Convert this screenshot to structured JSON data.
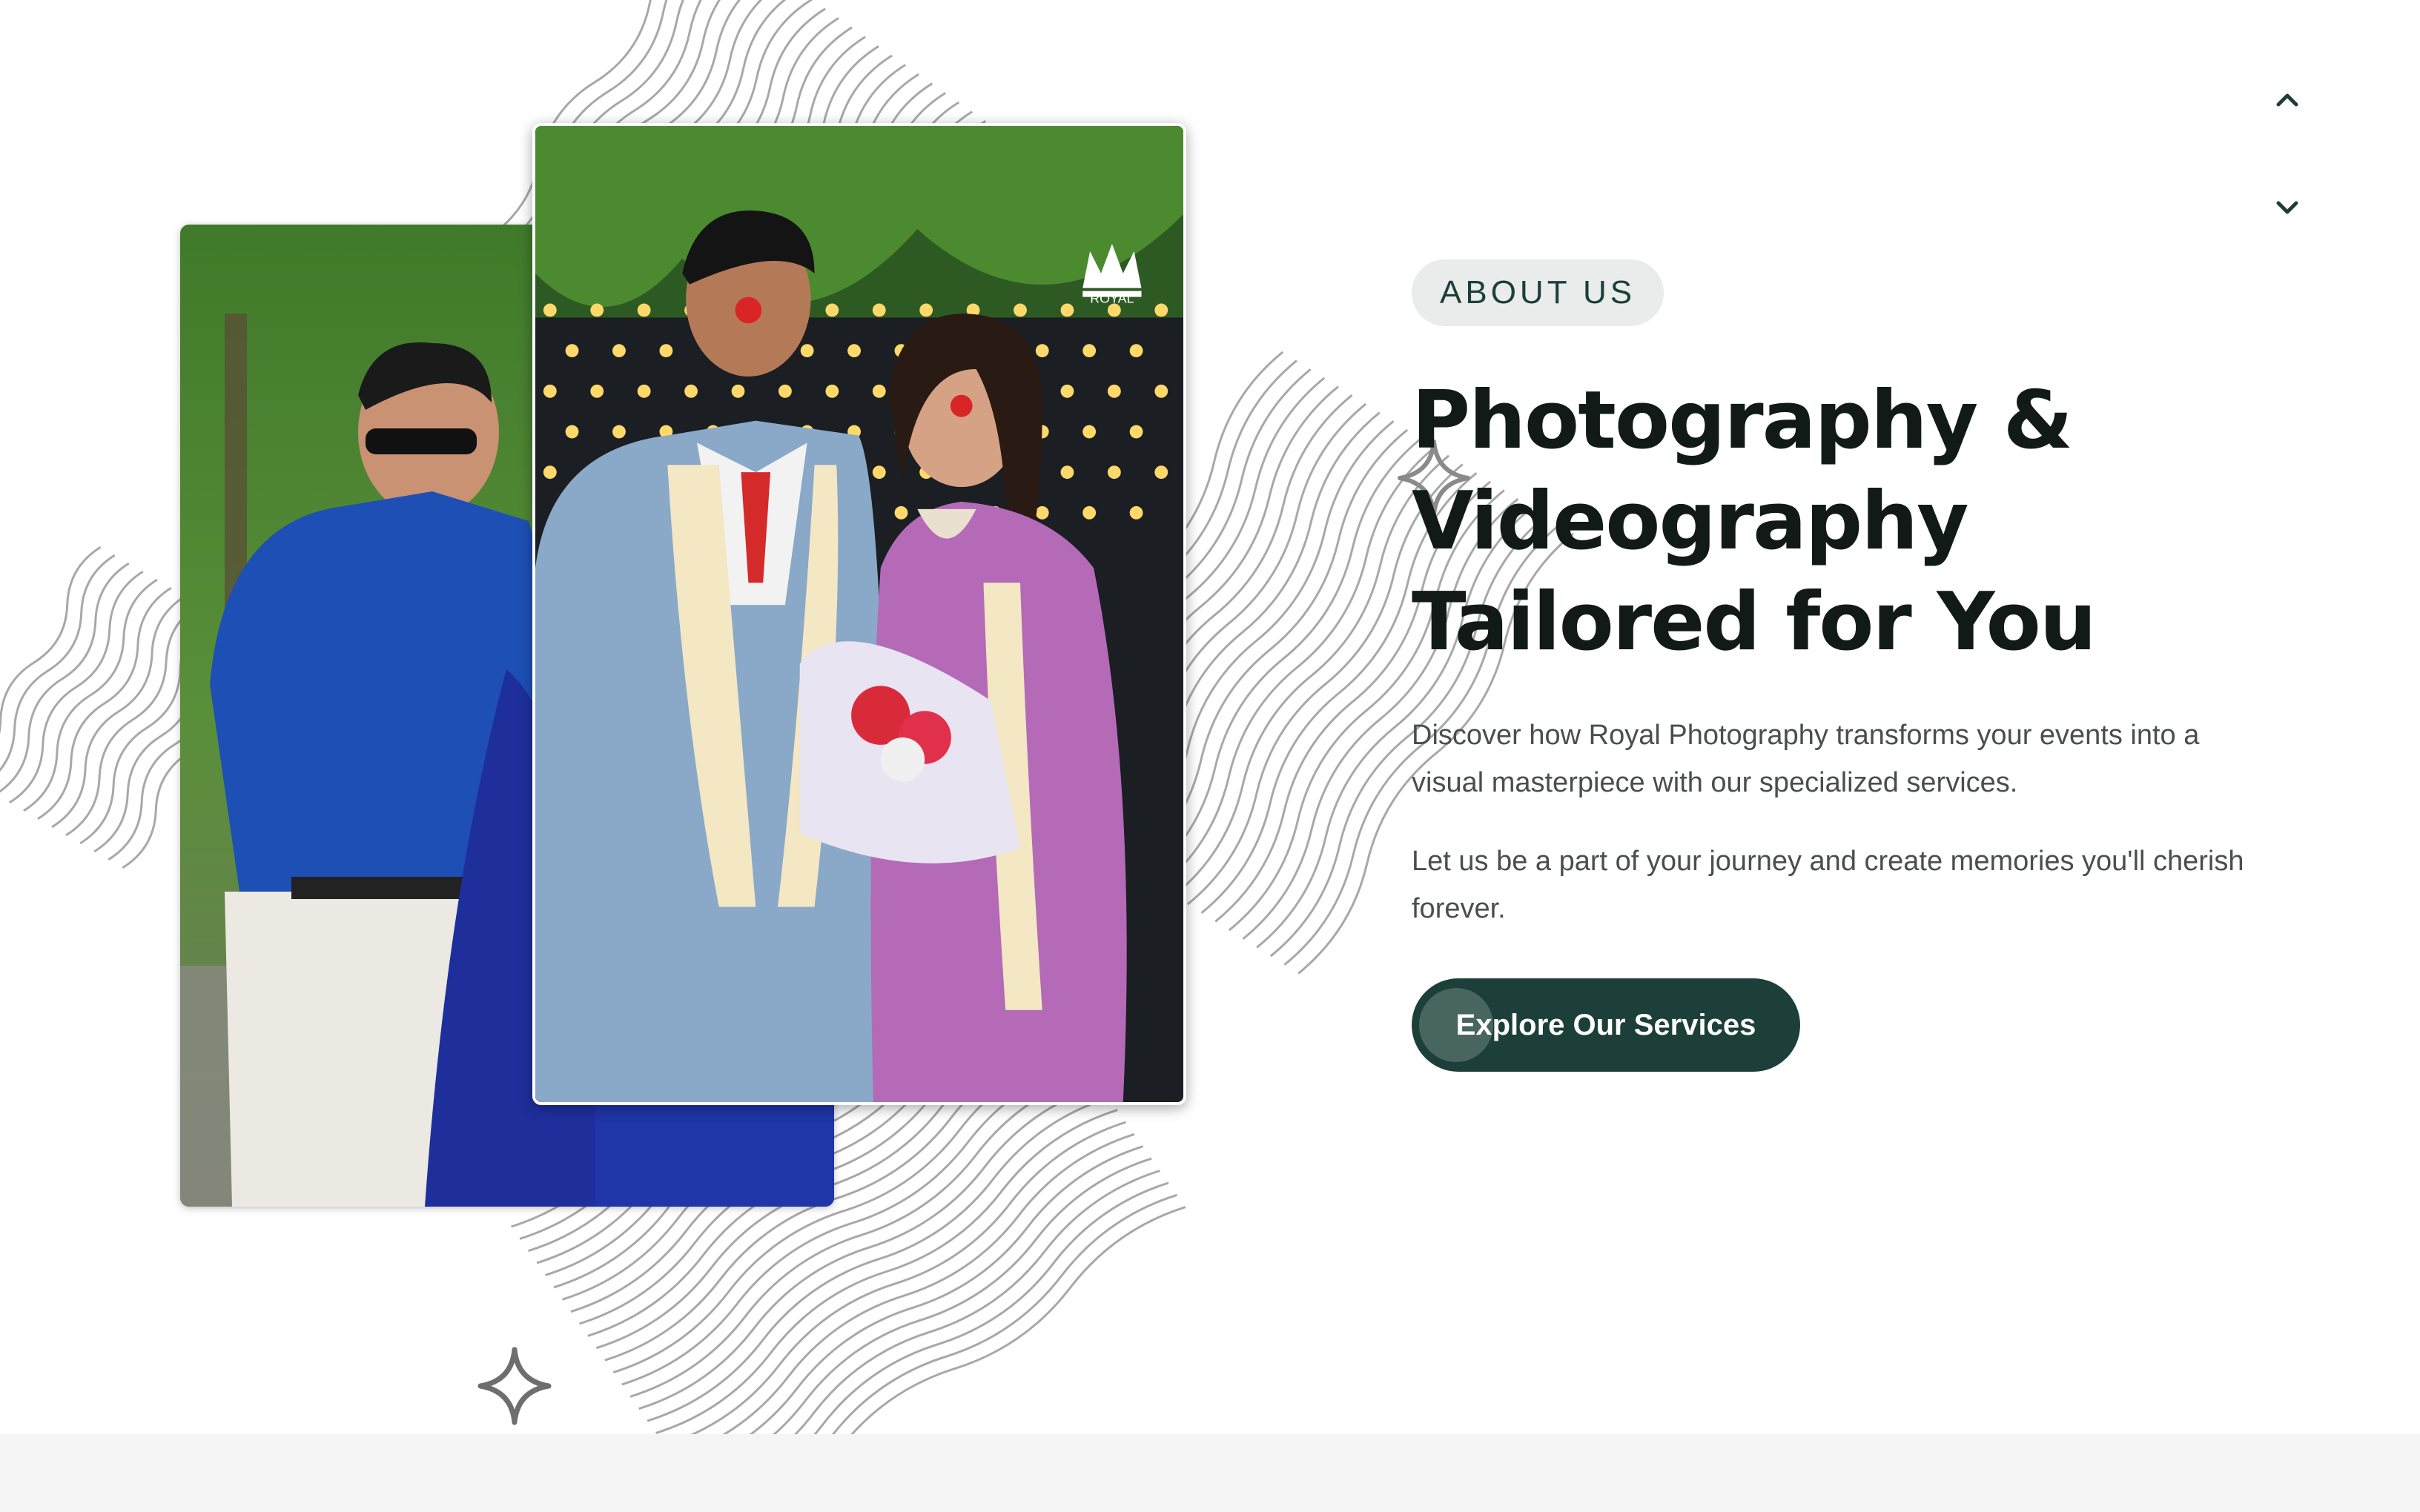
{
  "about": {
    "badge": "ABOUT US",
    "title_lines": [
      "Photography &",
      "Videography",
      "Tailored for You"
    ],
    "paragraph_1": "Discover how Royal Photography transforms your events into a visual masterpiece with our specialized services.",
    "paragraph_2": "Let us be a part of your journey and create memories you'll cherish forever.",
    "cta_label": "Explore Our Services"
  },
  "images": {
    "back_photo": "Family member in blue shirt beside couple",
    "front_photo": "Engaged couple with flower garlands and bouquet under string lights",
    "logo_text": "ROYAL"
  },
  "icons": {
    "scroll_up": "chevron-up-icon",
    "scroll_down": "chevron-down-icon",
    "sparkle": "sparkle-icon"
  },
  "colors": {
    "accent": "#1c3f39",
    "badge_bg": "#e9ecea",
    "heading": "#121a18",
    "body_text": "#4a4e4d",
    "footer_band": "#f5f5f5"
  }
}
